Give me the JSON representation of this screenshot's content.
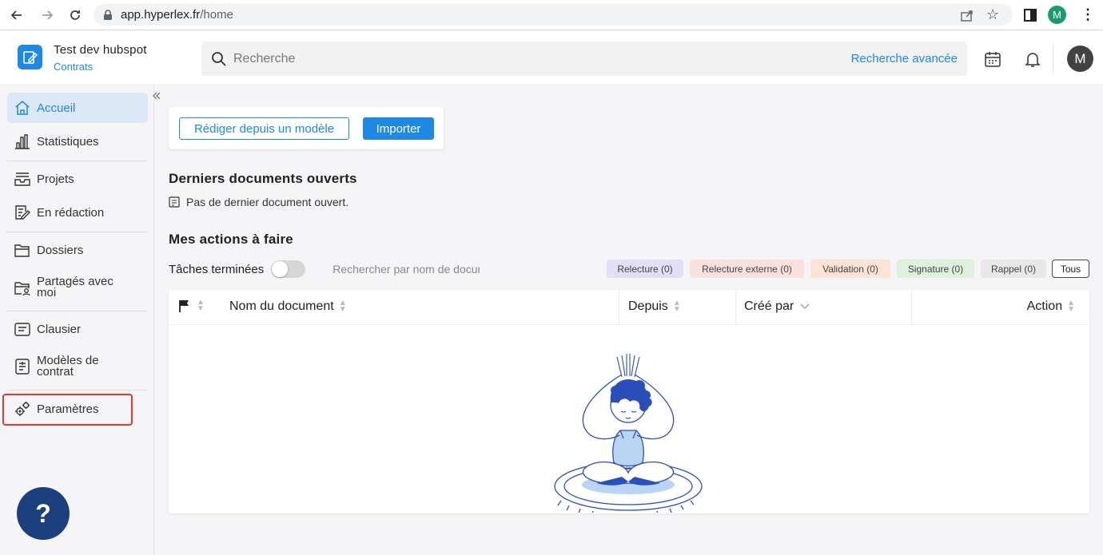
{
  "browser": {
    "url_host": "app.hyperlex.fr",
    "url_path": "/home",
    "profile_initial": "M"
  },
  "header": {
    "workspace_name": "Test dev hubspot",
    "workspace_sub": "Contrats",
    "search_placeholder": "Recherche",
    "advanced_search": "Recherche avancée",
    "avatar_initial": "M"
  },
  "sidebar": {
    "items": [
      {
        "label": "Accueil",
        "icon": "home-icon",
        "active": true
      },
      {
        "label": "Statistiques",
        "icon": "bar-chart-icon"
      },
      {
        "label": "Projets",
        "icon": "inbox-icon"
      },
      {
        "label": "En rédaction",
        "icon": "edit-document-icon"
      },
      {
        "label": "Dossiers",
        "icon": "folder-icon"
      },
      {
        "label": "Partagés avec",
        "label2": "moi",
        "icon": "shared-folder-icon"
      },
      {
        "label": "Clausier",
        "icon": "clause-icon"
      },
      {
        "label": "Modèles de",
        "label2": "contrat",
        "icon": "template-icon"
      },
      {
        "label": "Paramètres",
        "icon": "gears-icon"
      }
    ],
    "help_label": "?"
  },
  "main": {
    "draft_from_template": "Rédiger depuis un modèle",
    "import": "Importer",
    "recent_title": "Derniers documents ouverts",
    "recent_empty": "Pas de dernier document ouvert.",
    "todo_title": "Mes actions à faire",
    "completed_tasks": "Tâches terminées",
    "search_doc_placeholder": "Rechercher par nom de document",
    "filters": [
      {
        "label": "Relecture (0)",
        "color": "#e3e0f6"
      },
      {
        "label": "Relecture externe (0)",
        "color": "#fbe0e0"
      },
      {
        "label": "Validation (0)",
        "color": "#fce3d6"
      },
      {
        "label": "Signature (0)",
        "color": "#dff1dc"
      },
      {
        "label": "Rappel (0)",
        "color": "#e8e8e8"
      },
      {
        "label": "Tous",
        "color": "#ffffff"
      }
    ],
    "columns": [
      "Nom du document",
      "Depuis",
      "Créé par",
      "Action"
    ]
  },
  "colors": {
    "accent": "#1e88e5",
    "help": "#1c3f7d",
    "highlight": "#e53935"
  }
}
